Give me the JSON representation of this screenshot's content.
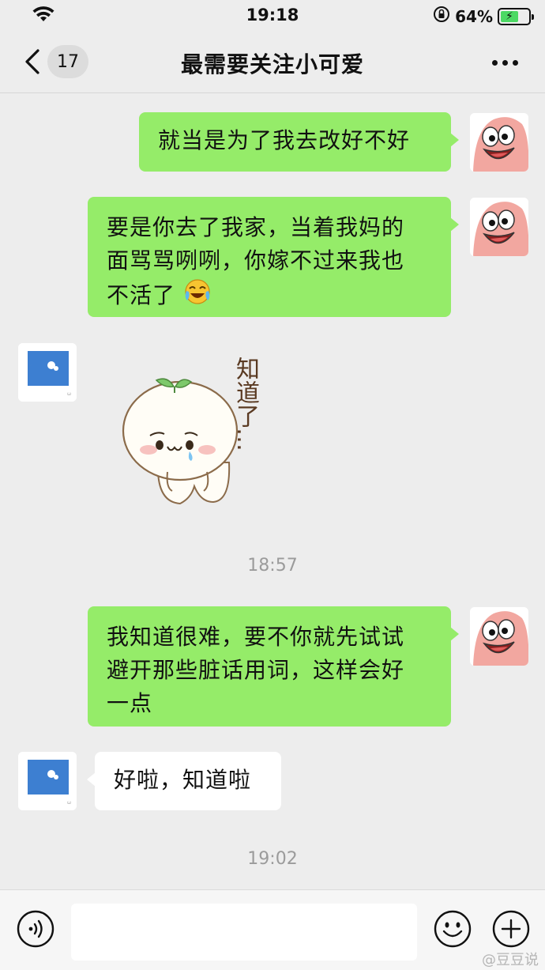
{
  "status_bar": {
    "time": "19:18",
    "battery_percent": "64%",
    "battery_level": 0.64,
    "icons": [
      "wifi-icon",
      "orientation-lock-icon",
      "battery-charging-icon"
    ]
  },
  "nav": {
    "unread_count": "17",
    "title": "最需要关注小可爱",
    "icons": [
      "chevron-left-icon",
      "more-dots-icon"
    ]
  },
  "messages": [
    {
      "sender": "me",
      "text": "就当是为了我去改好不好"
    },
    {
      "sender": "me",
      "text_lines": [
        "要是你去了我家，当着我妈的",
        "面骂骂咧咧，你嫁不过来我也",
        "不活了"
      ],
      "emoji": "crying-laughing-face"
    },
    {
      "sender": "them",
      "sticker_text": "知道了…",
      "sticker": "crying-bun-sticker"
    },
    {
      "sender": "me",
      "text_lines": [
        "我知道很难，要不你就先试试",
        "避开那些脏话用词，这样会好",
        "一点"
      ]
    },
    {
      "sender": "them",
      "text": "好啦，知道啦"
    }
  ],
  "timestamps": [
    "18:57",
    "19:02"
  ],
  "input_bar": {
    "placeholder": "",
    "icons": [
      "voice-icon",
      "emoji-icon",
      "plus-icon"
    ]
  },
  "watermark": "@豆豆说",
  "colors": {
    "my_bubble": "#95ec69",
    "their_bubble": "#ffffff",
    "background": "#ededed"
  }
}
